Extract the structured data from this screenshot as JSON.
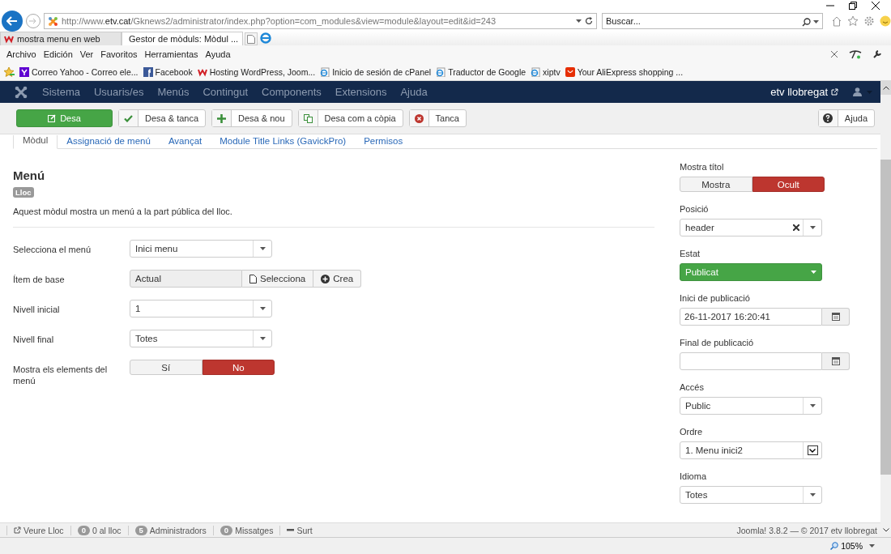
{
  "browser": {
    "url": "http://www.**etv.cat**/Gknews2/administrator/index.php?option=com_modules&view=module&layout=edit&id=243",
    "search_placeholder": "Buscar...",
    "tabs": [
      {
        "label": "mostra menu en web",
        "selected": false
      },
      {
        "label": "Gestor de mòduls: Mòdul ...",
        "selected": true
      }
    ],
    "menu": [
      "Archivo",
      "Edición",
      "Ver",
      "Favoritos",
      "Herramientas",
      "Ayuda"
    ],
    "favorites": [
      {
        "label": "Correo Yahoo - Correo ele...",
        "kind": "yahoo"
      },
      {
        "label": "Facebook",
        "kind": "facebook"
      },
      {
        "label": "Hosting WordPress, Joom...",
        "kind": "host"
      },
      {
        "label": "Inicio de sesión de cPanel",
        "kind": "ie"
      },
      {
        "label": "Traductor de Google",
        "kind": "ie"
      },
      {
        "label": "xiptv",
        "kind": "ie"
      },
      {
        "label": "Your AliExpress shopping ...",
        "kind": "shop"
      }
    ],
    "zoom": "105%"
  },
  "nav": {
    "items": [
      "Sistema",
      "Usuaris/es",
      "Menús",
      "Contingut",
      "Components",
      "Extensions",
      "Ajuda"
    ],
    "site": "etv llobregat"
  },
  "toolbar": {
    "buttons": [
      {
        "label": "Desa",
        "kind": "save"
      },
      {
        "label": "Desa & tanca",
        "kind": "check"
      },
      {
        "label": "Desa & nou",
        "kind": "plus"
      },
      {
        "label": "Desa com a còpia",
        "kind": "copy"
      },
      {
        "label": "Tanca",
        "kind": "cancel"
      }
    ],
    "help": "Ajuda"
  },
  "tabs": [
    {
      "label": "Mòdul",
      "selected": true
    },
    {
      "label": "Assignació de menú",
      "selected": false
    },
    {
      "label": "Avançat",
      "selected": false
    },
    {
      "label": "Module Title Links (GavickPro)",
      "selected": false
    },
    {
      "label": "Permisos",
      "selected": false
    }
  ],
  "module": {
    "title": "Menú",
    "badge": "Lloc",
    "description": "Aquest mòdul mostra un menú a la part pública del lloc.",
    "fields": [
      {
        "label": "Selecciona el menú",
        "kind": "select",
        "value": "Inici menu"
      },
      {
        "label": "Ítem de base",
        "kind": "modal",
        "value": "Actual",
        "buttons": [
          "Selecciona",
          "Crea"
        ]
      },
      {
        "label": "Nivell inicial",
        "kind": "select",
        "value": "1"
      },
      {
        "label": "Nivell final",
        "kind": "select",
        "value": "Totes"
      },
      {
        "label": "Mostra els elements del menú",
        "kind": "toggle",
        "options": [
          {
            "label": "Sí",
            "selected": false
          },
          {
            "label": "No",
            "selected": true
          }
        ]
      }
    ]
  },
  "sidebar": [
    {
      "label": "Mostra títol",
      "kind": "toggle",
      "options": [
        {
          "label": "Mostra",
          "selected": false
        },
        {
          "label": "Ocult",
          "selected": true
        }
      ]
    },
    {
      "label": "Posició",
      "kind": "chosen",
      "value": "header"
    },
    {
      "label": "Estat",
      "kind": "status",
      "value": "Publicat"
    },
    {
      "label": "Inici de publicació",
      "kind": "date",
      "value": "26-11-2017 16:20:41"
    },
    {
      "label": "Final de publicació",
      "kind": "date"
    },
    {
      "label": "Accés",
      "kind": "select",
      "value": "Public"
    },
    {
      "label": "Ordre",
      "kind": "native",
      "value": "1. Menu inici2"
    },
    {
      "label": "Idioma",
      "kind": "select",
      "value": "Totes"
    }
  ],
  "footer": {
    "items": [
      {
        "kind": "link",
        "label": "Veure Lloc"
      },
      {
        "kind": "count",
        "count": "0",
        "label": "0 al lloc"
      },
      {
        "kind": "count",
        "count": "5",
        "label": "Administradors"
      },
      {
        "kind": "count",
        "count": "0",
        "label": "Missatges"
      },
      {
        "kind": "logout",
        "label": "Surt"
      }
    ],
    "copyright": "Joomla! 3.8.2 — © 2017 etv llobregat"
  }
}
